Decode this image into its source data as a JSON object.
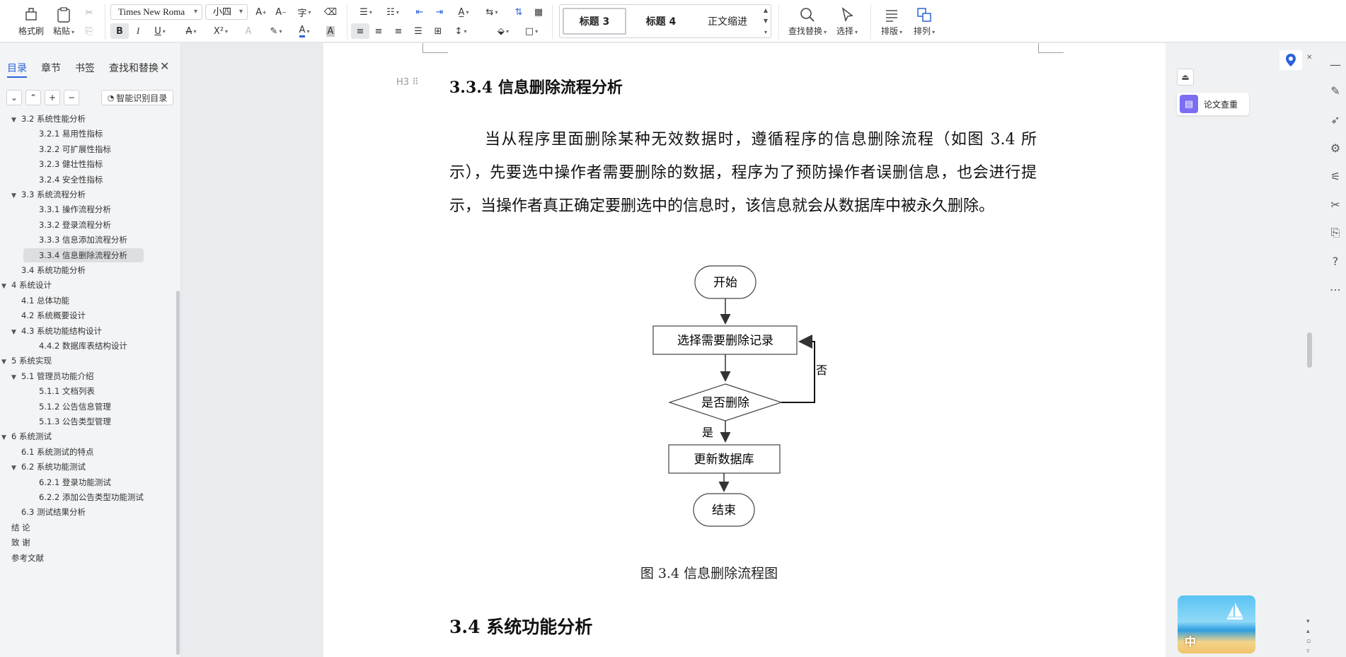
{
  "ribbon": {
    "format_painter": "格式刷",
    "paste": "粘贴",
    "font_name": "Times New Roma",
    "font_size": "小四",
    "styles": [
      "标题 3",
      "标题 4",
      "正文缩进"
    ],
    "find_replace": "查找替换",
    "select": "选择",
    "typeset": "排版",
    "arrange": "排列",
    "bold": "B",
    "italic": "I",
    "underline": "U",
    "font_color_letter": "A",
    "superscript": "X²"
  },
  "left_panel": {
    "tabs": [
      "目录",
      "章节",
      "书签",
      "查找和替换"
    ],
    "smart_toc": "智能识别目录",
    "toc": [
      {
        "label": "3.2  系统性能分析",
        "level": 2,
        "expanded": true,
        "selected": false
      },
      {
        "label": "3.2.1  易用性指标",
        "level": 3,
        "expanded": false,
        "selected": false
      },
      {
        "label": "3.2.2  可扩展性指标",
        "level": 3,
        "expanded": false,
        "selected": false
      },
      {
        "label": "3.2.3  健壮性指标",
        "level": 3,
        "expanded": false,
        "selected": false
      },
      {
        "label": "3.2.4  安全性指标",
        "level": 3,
        "expanded": false,
        "selected": false
      },
      {
        "label": "3.3  系统流程分析",
        "level": 2,
        "expanded": true,
        "selected": false
      },
      {
        "label": "3.3.1  操作流程分析",
        "level": 3,
        "expanded": false,
        "selected": false
      },
      {
        "label": "3.3.2  登录流程分析",
        "level": 3,
        "expanded": false,
        "selected": false
      },
      {
        "label": "3.3.3  信息添加流程分析",
        "level": 3,
        "expanded": false,
        "selected": false
      },
      {
        "label": "3.3.4  信息删除流程分析",
        "level": 3,
        "expanded": false,
        "selected": true
      },
      {
        "label": "3.4  系统功能分析",
        "level": 2,
        "expanded": false,
        "selected": false
      },
      {
        "label": "4  系统设计",
        "level": 1,
        "expanded": true,
        "selected": false
      },
      {
        "label": "4.1  总体功能",
        "level": 2,
        "expanded": false,
        "selected": false
      },
      {
        "label": "4.2  系统概要设计",
        "level": 2,
        "expanded": false,
        "selected": false
      },
      {
        "label": "4.3  系统功能结构设计",
        "level": 2,
        "expanded": true,
        "selected": false
      },
      {
        "label": "4.4.2  数据库表结构设计",
        "level": 3,
        "expanded": false,
        "selected": false
      },
      {
        "label": "5  系统实现",
        "level": 1,
        "expanded": true,
        "selected": false
      },
      {
        "label": "5.1  管理员功能介绍",
        "level": 2,
        "expanded": true,
        "selected": false
      },
      {
        "label": "5.1.1  文档列表",
        "level": 3,
        "expanded": false,
        "selected": false
      },
      {
        "label": "5.1.2  公告信息管理",
        "level": 3,
        "expanded": false,
        "selected": false
      },
      {
        "label": "5.1.3 公告类型管理",
        "level": 3,
        "expanded": false,
        "selected": false
      },
      {
        "label": "6  系统测试",
        "level": 1,
        "expanded": true,
        "selected": false
      },
      {
        "label": "6.1  系统测试的特点",
        "level": 2,
        "expanded": false,
        "selected": false
      },
      {
        "label": "6.2  系统功能测试",
        "level": 2,
        "expanded": true,
        "selected": false
      },
      {
        "label": "6.2.1  登录功能测试",
        "level": 3,
        "expanded": false,
        "selected": false
      },
      {
        "label": "6.2.2  添加公告类型功能测试",
        "level": 3,
        "expanded": false,
        "selected": false
      },
      {
        "label": "6.3  测试结果分析",
        "level": 2,
        "expanded": false,
        "selected": false
      },
      {
        "label": "结    论",
        "level": 1,
        "expanded": false,
        "selected": false
      },
      {
        "label": "致    谢",
        "level": 1,
        "expanded": false,
        "selected": false
      },
      {
        "label": "参考文献",
        "level": 1,
        "expanded": false,
        "selected": false
      }
    ]
  },
  "document": {
    "heading_1": "3.3.4  信息删除流程分析",
    "paragraph": "当从程序里面删除某种无效数据时，遵循程序的信息删除流程（如图 3.4 所示），先要选中操作者需要删除的数据，程序为了预防操作者误删信息，也会进行提示，当操作者真正确定要删选中的信息时，该信息就会从数据库中被永久删除。",
    "flowchart": {
      "start": "开始",
      "select": "选择需要删除记录",
      "decision": "是否删除",
      "no_label": "否",
      "yes_label": "是",
      "update": "更新数据库",
      "end": "结束"
    },
    "caption": "图 3.4  信息删除流程图",
    "heading_2": "3.4  系统功能分析",
    "heading_marker": "H3"
  },
  "right_panel": {
    "paper_check": "论文查重",
    "game_text": "中"
  },
  "colors": {
    "accent": "#2a63d8",
    "selected_row": "#dcdee2",
    "paper_check_icon": "#7b6df2"
  }
}
